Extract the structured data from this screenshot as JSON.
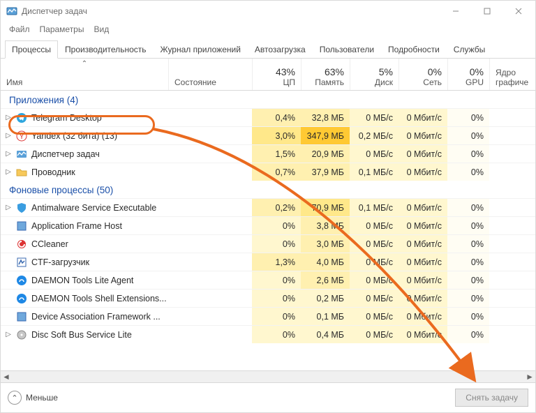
{
  "window": {
    "title": "Диспетчер задач"
  },
  "menu": {
    "file": "Файл",
    "options": "Параметры",
    "view": "Вид"
  },
  "tabs": {
    "processes": "Процессы",
    "performance": "Производительность",
    "app_history": "Журнал приложений",
    "startup": "Автозагрузка",
    "users": "Пользователи",
    "details": "Подробности",
    "services": "Службы"
  },
  "headers": {
    "name": "Имя",
    "state": "Состояние",
    "cpu_pct": "43%",
    "cpu": "ЦП",
    "mem_pct": "63%",
    "mem": "Память",
    "disk_pct": "5%",
    "disk": "Диск",
    "net_pct": "0%",
    "net": "Сеть",
    "gpu_pct": "0%",
    "gpu": "GPU",
    "gpu_engine": "Ядро графиче"
  },
  "groups": {
    "apps": "Приложения (4)",
    "bg": "Фоновые процессы (50)"
  },
  "rows": [
    {
      "exp": true,
      "icon": "telegram",
      "name": "Telegram Desktop",
      "cpu": "0,4%",
      "cpuH": "h2",
      "mem": "32,8 МБ",
      "memH": "h2",
      "disk": "0 МБ/с",
      "diskH": "h1",
      "net": "0 Мбит/с",
      "netH": "h1",
      "gpu": "0%",
      "gpuH": "h0"
    },
    {
      "exp": true,
      "icon": "yandex",
      "name": "Yandex (32 бита) (13)",
      "cpu": "3,0%",
      "cpuH": "h3",
      "mem": "347,9 МБ",
      "memH": "h5",
      "disk": "0,2 МБ/с",
      "diskH": "h1",
      "net": "0 Мбит/с",
      "netH": "h1",
      "gpu": "0%",
      "gpuH": "h0"
    },
    {
      "exp": true,
      "icon": "taskmgr",
      "name": "Диспетчер задач",
      "cpu": "1,5%",
      "cpuH": "h2",
      "mem": "20,9 МБ",
      "memH": "h2",
      "disk": "0 МБ/с",
      "diskH": "h1",
      "net": "0 Мбит/с",
      "netH": "h1",
      "gpu": "0%",
      "gpuH": "h0"
    },
    {
      "exp": true,
      "icon": "explorer",
      "name": "Проводник",
      "cpu": "0,7%",
      "cpuH": "h2",
      "mem": "37,9 МБ",
      "memH": "h2",
      "disk": "0,1 МБ/с",
      "diskH": "h1",
      "net": "0 Мбит/с",
      "netH": "h1",
      "gpu": "0%",
      "gpuH": "h0"
    }
  ],
  "bgrows": [
    {
      "exp": true,
      "icon": "shield",
      "name": "Antimalware Service Executable",
      "cpu": "0,2%",
      "cpuH": "h2",
      "mem": "70,9 МБ",
      "memH": "h3",
      "disk": "0,1 МБ/с",
      "diskH": "h1",
      "net": "0 Мбит/с",
      "netH": "h1",
      "gpu": "0%",
      "gpuH": "h0"
    },
    {
      "exp": false,
      "icon": "app",
      "name": "Application Frame Host",
      "cpu": "0%",
      "cpuH": "h1",
      "mem": "3,8 МБ",
      "memH": "h2",
      "disk": "0 МБ/с",
      "diskH": "h1",
      "net": "0 Мбит/с",
      "netH": "h1",
      "gpu": "0%",
      "gpuH": "h0"
    },
    {
      "exp": false,
      "icon": "ccleaner",
      "name": "CCleaner",
      "cpu": "0%",
      "cpuH": "h1",
      "mem": "3,0 МБ",
      "memH": "h2",
      "disk": "0 МБ/с",
      "diskH": "h1",
      "net": "0 Мбит/с",
      "netH": "h1",
      "gpu": "0%",
      "gpuH": "h0"
    },
    {
      "exp": false,
      "icon": "ctf",
      "name": "CTF-загрузчик",
      "cpu": "1,3%",
      "cpuH": "h2",
      "mem": "4,0 МБ",
      "memH": "h2",
      "disk": "0 МБ/с",
      "diskH": "h1",
      "net": "0 Мбит/с",
      "netH": "h1",
      "gpu": "0%",
      "gpuH": "h0"
    },
    {
      "exp": false,
      "icon": "daemon",
      "name": "DAEMON Tools Lite Agent",
      "cpu": "0%",
      "cpuH": "h1",
      "mem": "2,6 МБ",
      "memH": "h2",
      "disk": "0 МБ/с",
      "diskH": "h1",
      "net": "0 Мбит/с",
      "netH": "h1",
      "gpu": "0%",
      "gpuH": "h0"
    },
    {
      "exp": false,
      "icon": "daemon",
      "name": "DAEMON Tools Shell Extensions...",
      "cpu": "0%",
      "cpuH": "h1",
      "mem": "0,2 МБ",
      "memH": "h1",
      "disk": "0 МБ/с",
      "diskH": "h1",
      "net": "0 Мбит/с",
      "netH": "h1",
      "gpu": "0%",
      "gpuH": "h0"
    },
    {
      "exp": false,
      "icon": "app",
      "name": "Device Association Framework ...",
      "cpu": "0%",
      "cpuH": "h1",
      "mem": "0,1 МБ",
      "memH": "h1",
      "disk": "0 МБ/с",
      "diskH": "h1",
      "net": "0 Мбит/с",
      "netH": "h1",
      "gpu": "0%",
      "gpuH": "h0"
    },
    {
      "exp": true,
      "icon": "disc",
      "name": "Disc Soft Bus Service Lite",
      "cpu": "0%",
      "cpuH": "h1",
      "mem": "0,4 МБ",
      "memH": "h1",
      "disk": "0 МБ/с",
      "diskH": "h1",
      "net": "0 Мбит/с",
      "netH": "h1",
      "gpu": "0%",
      "gpuH": "h0"
    }
  ],
  "footer": {
    "less": "Меньше",
    "end_task": "Снять задачу"
  }
}
